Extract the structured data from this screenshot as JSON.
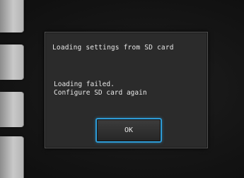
{
  "dialog": {
    "title": "Loading settings from SD card",
    "message_line1": "Loading failed.",
    "message_line2": "Configure SD card again",
    "ok_label": "OK"
  }
}
